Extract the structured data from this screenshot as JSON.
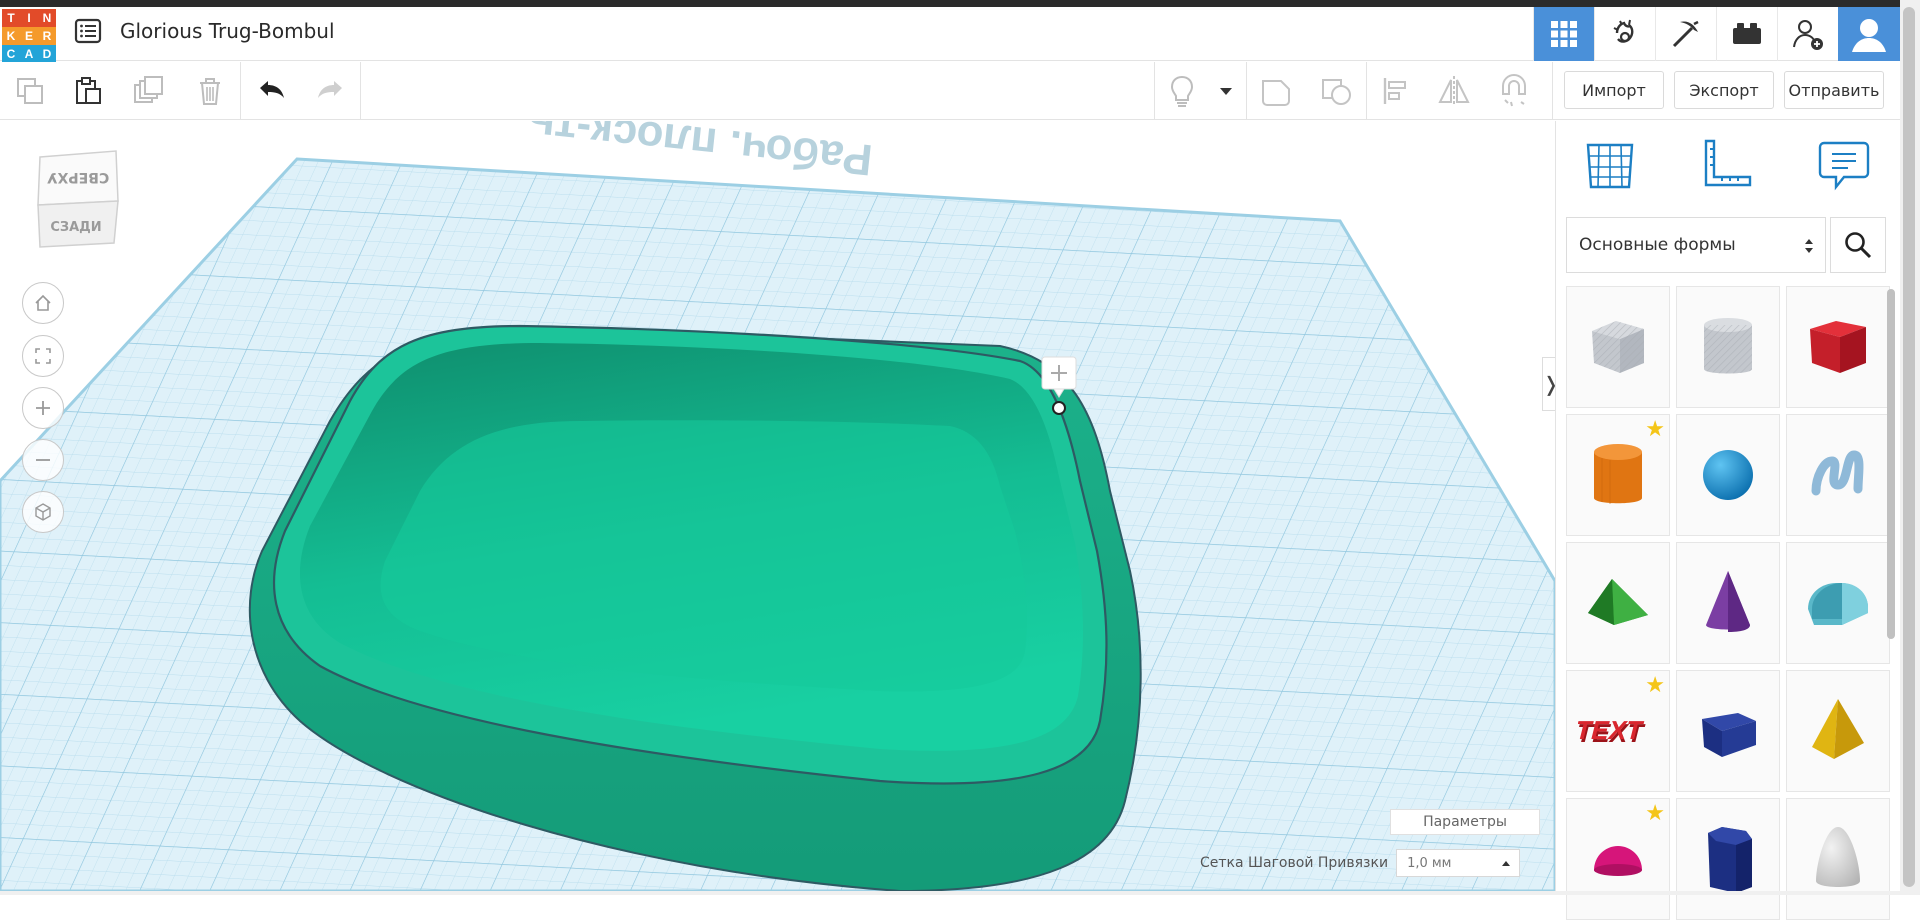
{
  "app": {
    "logo_letters": [
      "T",
      "I",
      "N",
      "K",
      "E",
      "R",
      "C",
      "A",
      "D"
    ],
    "logo_colors": [
      "#e24b29",
      "#e24b29",
      "#e24b29",
      "#f59a2b",
      "#f59a2b",
      "#f59a2b",
      "#23a4d8",
      "#23a4d8",
      "#23a4d8"
    ],
    "title": "Glorious Trug-Bombul",
    "top_icons": [
      "grid-view-icon",
      "gears-view-icon",
      "pickaxe-icon",
      "bricks-icon",
      "add-user-icon",
      "user-avatar"
    ],
    "accent": "#4a90d9"
  },
  "toolbar": {
    "left_icons": [
      "copy-icon",
      "paste-icon",
      "duplicate-icon",
      "delete-icon",
      "undo-icon",
      "redo-icon"
    ],
    "right_icons": [
      "light-bulb-icon",
      "dropdown-caret-icon",
      "group-icon",
      "ungroup-icon",
      "align-icon",
      "mirror-icon",
      "magnet-icon"
    ],
    "import_label": "Импорт",
    "export_label": "Экспорт",
    "send_label": "Отправить"
  },
  "viewport": {
    "view_cube_top": "СВЕРХУ",
    "view_cube_back": "СЗАДИ",
    "nav_icons": [
      "home-view-icon",
      "fit-view-icon",
      "zoom-in-icon",
      "zoom-out-icon",
      "perspective-icon"
    ],
    "workplane_label": "Рабоч. плоск-ть",
    "panel_toggle": "❭",
    "params_label": "Параметры",
    "snap_label": "Сетка Шаговой Привязки",
    "snap_value": "1,0 мм",
    "bowl_color": "#17c49c"
  },
  "right_panel": {
    "tab_icons": [
      "workplane-grid-icon",
      "ruler-icon",
      "notes-icon"
    ],
    "shape_category": "Основные формы",
    "search_icon": "search-icon",
    "shapes": [
      {
        "name": "box-hole-shape",
        "starred": false
      },
      {
        "name": "cylinder-hole-shape",
        "starred": false
      },
      {
        "name": "box-shape",
        "starred": false
      },
      {
        "name": "cylinder-shape",
        "starred": true
      },
      {
        "name": "sphere-shape",
        "starred": false
      },
      {
        "name": "scribble-shape",
        "starred": false
      },
      {
        "name": "roof-shape",
        "starred": false
      },
      {
        "name": "cone-shape",
        "starred": false
      },
      {
        "name": "round-roof-shape",
        "starred": false
      },
      {
        "name": "text-shape",
        "starred": true
      },
      {
        "name": "wedge-shape",
        "starred": false
      },
      {
        "name": "pyramid-shape",
        "starred": false
      },
      {
        "name": "half-sphere-shape",
        "starred": true
      },
      {
        "name": "polygon-shape",
        "starred": false
      },
      {
        "name": "paraboloid-shape",
        "starred": false
      }
    ],
    "text_shape_label": "TEXT"
  }
}
